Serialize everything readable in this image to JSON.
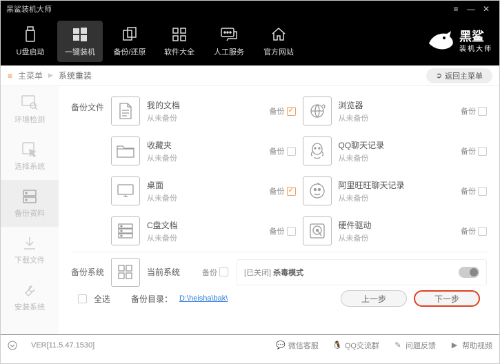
{
  "title": "黑鲨装机大师",
  "nav": {
    "items": [
      {
        "label": "U盘启动"
      },
      {
        "label": "一键装机"
      },
      {
        "label": "备份/还原"
      },
      {
        "label": "软件大全"
      },
      {
        "label": "人工服务"
      },
      {
        "label": "官方网站"
      }
    ]
  },
  "brand": {
    "name": "黑鲨",
    "sub": "装机大师"
  },
  "crumb": {
    "home": "主菜单",
    "sep": "▶",
    "page": "系统重装",
    "return": "返回主菜单"
  },
  "sidebar": {
    "items": [
      {
        "label": "环境检测"
      },
      {
        "label": "选择系统"
      },
      {
        "label": "备份资料"
      },
      {
        "label": "下载文件"
      },
      {
        "label": "安装系统"
      }
    ]
  },
  "sections": {
    "files": {
      "title": "备份文件"
    },
    "system": {
      "title": "备份系统"
    }
  },
  "labels": {
    "backup": "备份",
    "never": "从未备份"
  },
  "fileitems": [
    {
      "name": "我的文档",
      "status": "从未备份",
      "checked": true
    },
    {
      "name": "浏览器",
      "status": "从未备份",
      "checked": false
    },
    {
      "name": "收藏夹",
      "status": "从未备份",
      "checked": false
    },
    {
      "name": "QQ聊天记录",
      "status": "从未备份",
      "checked": false
    },
    {
      "name": "桌面",
      "status": "从未备份",
      "checked": true
    },
    {
      "name": "阿里旺旺聊天记录",
      "status": "从未备份",
      "checked": false
    },
    {
      "name": "C盘文档",
      "status": "从未备份",
      "checked": false
    },
    {
      "name": "硬件驱动",
      "status": "从未备份",
      "checked": false
    }
  ],
  "sysitem": {
    "name": "当前系统",
    "status": ""
  },
  "kill": {
    "prefix": "[已关闭] ",
    "label": "杀毒模式"
  },
  "footer": {
    "selectall": "全选",
    "dirlabel": "备份目录：",
    "dir": "D:\\heisha\\bak\\",
    "prev": "上一步",
    "next": "下一步"
  },
  "status": {
    "ver": "VER[11.5.47.1530]",
    "items": [
      "微信客服",
      "QQ交流群",
      "问题反馈",
      "帮助视频"
    ]
  }
}
